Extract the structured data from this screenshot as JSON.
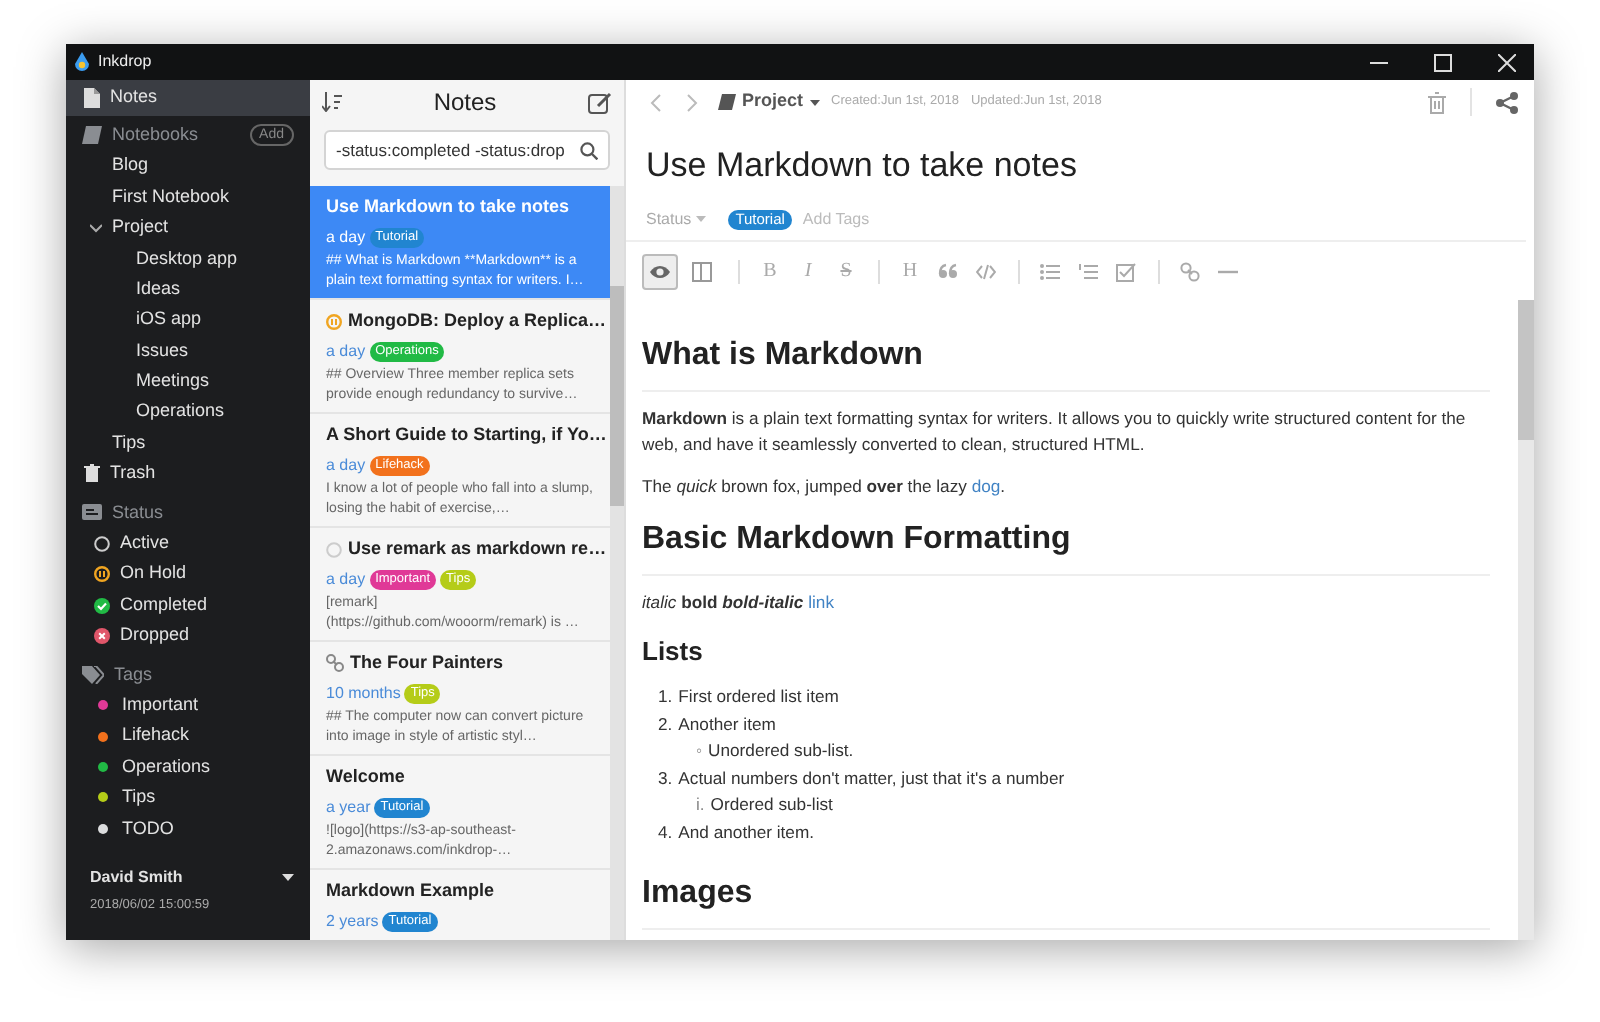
{
  "window": {
    "title": "Inkdrop"
  },
  "sidebar": {
    "notes": {
      "label": "Notes",
      "selected": true
    },
    "notebooks": {
      "label": "Notebooks",
      "add": "Add",
      "items": [
        {
          "label": "Blog",
          "selected": false
        },
        {
          "label": "First Notebook",
          "selected": false
        },
        {
          "label": "Project",
          "selected": false,
          "expanded": true,
          "children": [
            {
              "label": "Desktop app",
              "selected": false
            },
            {
              "label": "Ideas",
              "selected": false
            },
            {
              "label": "iOS app",
              "selected": false
            },
            {
              "label": "Issues",
              "selected": false
            },
            {
              "label": "Meetings",
              "selected": false
            },
            {
              "label": "Operations",
              "selected": false
            }
          ]
        },
        {
          "label": "Tips",
          "selected": false
        }
      ]
    },
    "trash": {
      "label": "Trash",
      "selected": false
    },
    "status": {
      "label": "Status",
      "items": [
        {
          "label": "Active",
          "kind": "active",
          "selected": false
        },
        {
          "label": "On Hold",
          "kind": "on-hold",
          "selected": false
        },
        {
          "label": "Completed",
          "kind": "completed",
          "selected": false
        },
        {
          "label": "Dropped",
          "kind": "dropped",
          "selected": false
        }
      ]
    },
    "tags": {
      "label": "Tags",
      "items": [
        {
          "label": "Important",
          "color": "#e03997",
          "selected": false
        },
        {
          "label": "Lifehack",
          "color": "#f2711c",
          "selected": false
        },
        {
          "label": "Operations",
          "color": "#21ba45",
          "selected": false
        },
        {
          "label": "Tips",
          "color": "#b5cc18",
          "selected": false
        },
        {
          "label": "TODO",
          "color": "#dcddde",
          "selected": false
        }
      ]
    },
    "user": {
      "name": "David Smith",
      "date": "2018/06/02 15:00:59"
    }
  },
  "note_list": {
    "title": "Notes",
    "search": {
      "value": "-status:completed -status:drop"
    },
    "notes": [
      {
        "title": "Use Markdown to take notes",
        "kind": "plain",
        "time": "a day",
        "tags": [
          {
            "label": "Tutorial",
            "color": "#2185d0"
          }
        ],
        "excerpt": "## What is Markdown **Markdown** is a plain text formatting syntax for writers. I…",
        "selected": true
      },
      {
        "title": "MongoDB: Deploy a Replica…",
        "kind": "on-hold",
        "time": "a day",
        "tags": [
          {
            "label": "Operations",
            "color": "#21ba45"
          }
        ],
        "excerpt": "## Overview Three member replica sets provide enough redundancy to survive…",
        "selected": false
      },
      {
        "title": "A Short Guide to Starting, if Yo…",
        "kind": "plain",
        "time": "a day",
        "tags": [
          {
            "label": "Lifehack",
            "color": "#f2711c"
          }
        ],
        "excerpt": "I know a lot of people who fall into a slump, losing the habit of exercise,…",
        "selected": false
      },
      {
        "title": "Use remark as markdown re…",
        "kind": "active",
        "time": "a day",
        "tags": [
          {
            "label": "Important",
            "color": "#e03997"
          },
          {
            "label": "Tips",
            "color": "#b5cc18"
          }
        ],
        "excerpt": "[remark](https://github.com/wooorm/remark) is …",
        "selected": false
      },
      {
        "title": "The Four Painters",
        "kind": "link",
        "time": "10 months",
        "tags": [
          {
            "label": "Tips",
            "color": "#b5cc18"
          }
        ],
        "excerpt": "## The computer now can convert picture into image in style of artistic styl…",
        "selected": false
      },
      {
        "title": "Welcome",
        "kind": "plain",
        "time": "a year",
        "tags": [
          {
            "label": "Tutorial",
            "color": "#2185d0"
          }
        ],
        "excerpt": "![logo](https://s3-ap-southeast-2.amazonaws.com/inkdrop-…",
        "selected": false
      },
      {
        "title": "Markdown Example",
        "kind": "plain",
        "time": "2 years",
        "tags": [
          {
            "label": "Tutorial",
            "color": "#2185d0"
          }
        ],
        "selected": false
      }
    ]
  },
  "editor": {
    "notebook": "Project",
    "created": "Created:Jun 1st, 2018",
    "updated": "Updated:Jun 1st, 2018",
    "title": "Use Markdown to take notes",
    "status": "Status",
    "tags": [
      {
        "label": "Tutorial",
        "color": "#2185d0"
      }
    ],
    "tag_input": {
      "placeholder": "Add Tags"
    },
    "toolbar": [
      [
        {
          "kind": "preview",
          "selected": true
        },
        {
          "kind": "split",
          "selected": false
        }
      ],
      [
        {
          "kind": "bold",
          "glyph": "B",
          "selected": false
        },
        {
          "kind": "italic",
          "glyph": "I",
          "selected": false
        },
        {
          "kind": "strike",
          "glyph": "S",
          "selected": false
        }
      ],
      [
        {
          "kind": "heading",
          "glyph": "H",
          "selected": false
        },
        {
          "kind": "quote",
          "selected": false
        },
        {
          "kind": "code",
          "selected": false
        }
      ],
      [
        {
          "kind": "bullets",
          "selected": false
        },
        {
          "kind": "numbers",
          "selected": false
        },
        {
          "kind": "task",
          "selected": false
        }
      ],
      [
        {
          "kind": "link",
          "selected": false
        },
        {
          "kind": "rule",
          "selected": false
        }
      ]
    ],
    "content": [
      {
        "kind": "h1",
        "text": "What is Markdown"
      },
      {
        "kind": "p",
        "text": "**Markdown** is a plain text formatting syntax for writers. It allows you to quickly write structured content for the web, and have it seamlessly converted to clean, structured HTML."
      },
      {
        "kind": "p",
        "text": "The *quick* brown fox, jumped **over** the lazy ",
        "link": "dog",
        "tail": "."
      },
      {
        "kind": "h1",
        "text": "Basic Markdown Formatting"
      },
      {
        "kind": "p",
        "text": "*italic* **bold** ",
        "bold_italic": "bold-italic",
        "link": "link"
      },
      {
        "kind": "h2",
        "text": "Lists"
      },
      {
        "kind": "list",
        "items": [
          {
            "marker": "1.",
            "text": "First ordered list item"
          },
          {
            "marker": "2.",
            "text": "Another item",
            "children": [
              {
                "marker": "◦",
                "text": "Unordered sub-list."
              }
            ]
          },
          {
            "marker": "3.",
            "text": "Actual numbers don't matter, just that it's a number",
            "children": [
              {
                "marker": "i.",
                "text": "Ordered sub-list"
              }
            ]
          },
          {
            "marker": "4.",
            "text": "And another item."
          }
        ]
      },
      {
        "kind": "h1",
        "text": "Images"
      }
    ]
  }
}
